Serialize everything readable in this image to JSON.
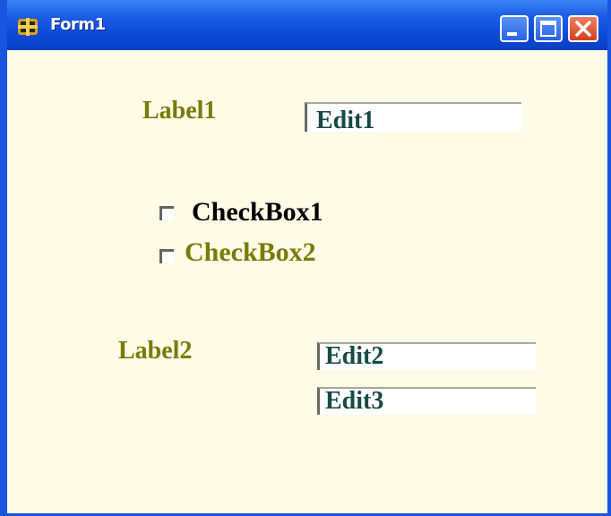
{
  "window": {
    "title": "Form1",
    "minimize_icon": "minimize-icon",
    "maximize_icon": "maximize-icon",
    "close_icon": "close-icon",
    "app_icon": "delphi-app-icon"
  },
  "colors": {
    "titlebar": "#0c49d6",
    "client_bg": "#fefbe6",
    "label_text": "#7b7a05",
    "edit_text": "#174a44",
    "checkbox1_text": "#000000",
    "checkbox2_text": "#7b7a05"
  },
  "form": {
    "label1": "Label1",
    "edit1": "Edit1",
    "checkbox1": "CheckBox1",
    "checkbox2": "CheckBox2",
    "label2": "Label2",
    "edit2": "Edit2",
    "edit3": "Edit3"
  }
}
